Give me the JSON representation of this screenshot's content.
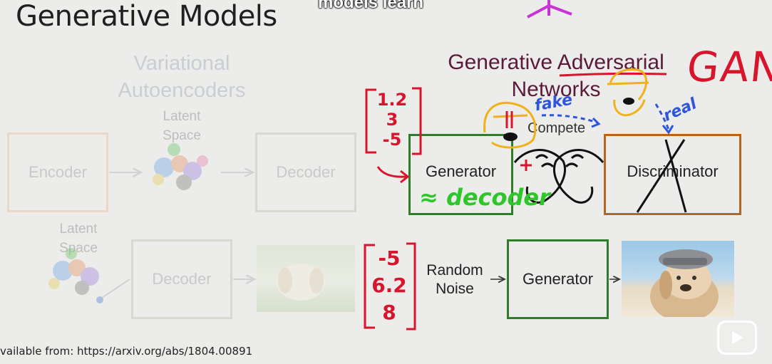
{
  "slide": {
    "title": "Generative Models",
    "caption": "models learn",
    "citation": "vailable from: https://arxiv.org/abs/1804.00891"
  },
  "vae": {
    "heading_line1": "Variational",
    "heading_line2": "Autoencoders",
    "latent_line1": "Latent",
    "latent_line2": "Space",
    "encoder": "Encoder",
    "decoder": "Decoder",
    "latent2_line1": "Latent",
    "latent2_line2": "Space",
    "decoder2": "Decoder"
  },
  "gan": {
    "heading_line1": "Generative Adversarial",
    "heading_line2": "Networks",
    "compete": "Compete",
    "generator": "Generator",
    "discriminator": "Discriminator",
    "random_line1": "Random",
    "random_line2": "Noise",
    "generator2": "Generator"
  },
  "annotations": {
    "gan": "GAN",
    "fake": "fake",
    "real": "real",
    "approx_decoder": "≈ decoder",
    "vector1": [
      "1.2",
      "3",
      "-5"
    ],
    "vector2": [
      "-5",
      "6.2",
      "8"
    ]
  },
  "colors": {
    "generator_border": "#2f7d2a",
    "discriminator_border": "#b5651d",
    "annotation_red": "#d8152c",
    "annotation_green": "#2ec62a",
    "annotation_blue": "#2d56e0",
    "annotation_yellow": "#f0b21a"
  },
  "icons": [
    "arm-wrestling-icon",
    "play-icon"
  ]
}
